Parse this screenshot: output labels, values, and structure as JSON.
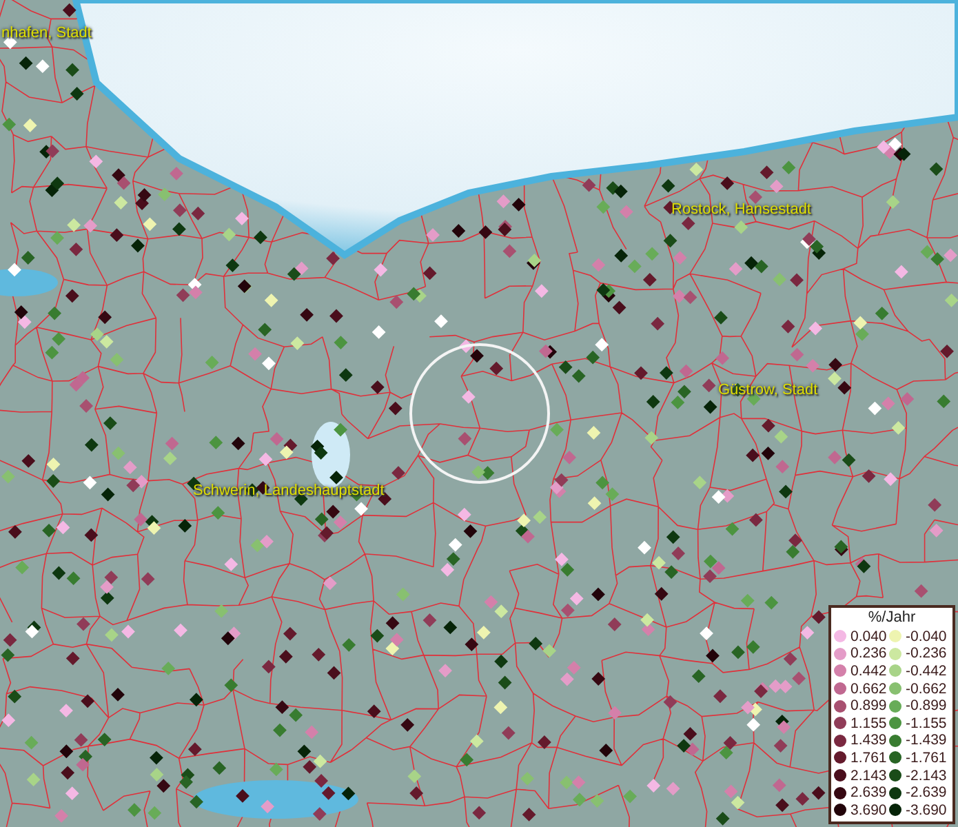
{
  "places": [
    {
      "name": "nhafen, Stadt"
    },
    {
      "name": "Rostock, Hansestadt"
    },
    {
      "name": "Güstrow, Stadt"
    },
    {
      "name": "Schwerin, Landeshauptstadt"
    }
  ],
  "legend": {
    "title": "%/Jahr",
    "items": [
      {
        "label": "0.040",
        "color": "#f4b8e4"
      },
      {
        "label": "0.236",
        "color": "#e49cc8"
      },
      {
        "label": "0.442",
        "color": "#d480aa"
      },
      {
        "label": "0.662",
        "color": "#c06890"
      },
      {
        "label": "0.899",
        "color": "#a85070"
      },
      {
        "label": "1.155",
        "color": "#903c58"
      },
      {
        "label": "1.439",
        "color": "#7a2840"
      },
      {
        "label": "1.761",
        "color": "#641a2c"
      },
      {
        "label": "2.143",
        "color": "#4a0e1c"
      },
      {
        "label": "2.639",
        "color": "#360812"
      },
      {
        "label": "3.690",
        "color": "#22040a"
      },
      {
        "label": "-0.040",
        "color": "#eef4b0"
      },
      {
        "label": "-0.236",
        "color": "#cce8a0"
      },
      {
        "label": "-0.442",
        "color": "#a8d488"
      },
      {
        "label": "-0.662",
        "color": "#88c070"
      },
      {
        "label": "-0.899",
        "color": "#68ac58"
      },
      {
        "label": "-1.155",
        "color": "#4c9440"
      },
      {
        "label": "-1.439",
        "color": "#387c30"
      },
      {
        "label": "-1.761",
        "color": "#286424"
      },
      {
        "label": "-2.143",
        "color": "#1a4c18"
      },
      {
        "label": "-2.639",
        "color": "#0e3810"
      },
      {
        "label": "-3.690",
        "color": "#062408"
      }
    ]
  }
}
